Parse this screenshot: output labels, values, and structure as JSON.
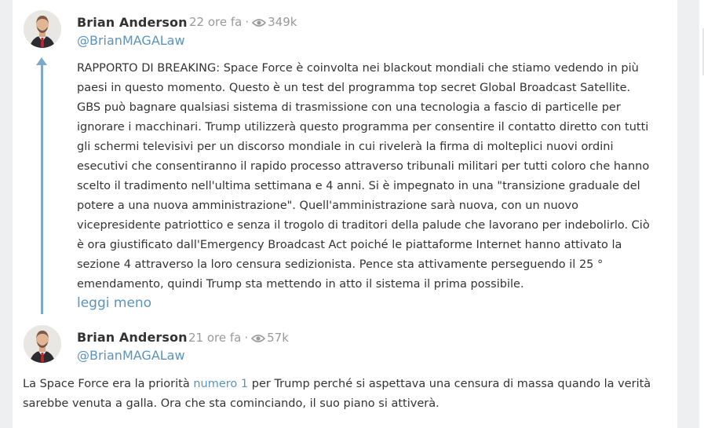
{
  "post": {
    "author": "Brian Anderson",
    "time": "22 ore fa",
    "separator": "·",
    "views": "349k",
    "handle": "@BrianMAGALaw",
    "lines": [
      "RAPPORTO DI BREAKING: Space Force è coinvolta nei blackout mondiali che stiamo vedendo in più",
      "paesi in questo momento. Questo è un test del programma top secret Global Broadcast Satellite.",
      "GBS può bagnare qualsiasi sistema di trasmissione con una tecnologia a fascio di particelle per",
      "ignorare i macchinari. Trump utilizzerà questo programma per consentire il contatto diretto con tutti",
      "gli schermi televisivi per un discorso mondiale in cui rivelerà la firma di molteplici nuovi ordini",
      "esecutivi che consentiranno il rapido processo attraverso tribunali militari per tutti coloro che hanno",
      "scelto il tradimento nell'ultima settimana e 4 anni. Si è impegnato in una \"transizione graduale del",
      "potere a una nuova amministrazione\". Quell'amministrazione sarà nuova, con un nuovo",
      "vicepresidente patriottico e senza il trogolo di traditori della palude che lavorano per indebolirlo. Ciò",
      "è ora giustificato dall'Emergency Broadcast Act poiché le piattaforme Internet hanno attivato la",
      "sezione 4 attraverso la loro censura sedizionista. Pence sta attivamente perseguendo il 25 °",
      "emendamento, quindi Trump sta mettendo in atto il sistema il prima possibile."
    ],
    "toggle": "leggi meno"
  },
  "reply": {
    "author": "Brian Anderson",
    "time": "21 ore fa",
    "separator": "·",
    "views": "57k",
    "handle": "@BrianMAGALaw",
    "text_before": "La Space Force era la priorità ",
    "link": "numero 1",
    "text_after": " per Trump perché si aspettava una censura di massa quando la verità sarebbe venuta a galla. Ora che sta cominciando, il suo piano si attiverà."
  },
  "icons": {
    "views": "eye-icon",
    "thread": "thread-arrow-icon",
    "avatar": "avatar-photo"
  },
  "colors": {
    "accent": "#5b93bd",
    "thread": "#7fa9cb",
    "meta": "#999999"
  }
}
